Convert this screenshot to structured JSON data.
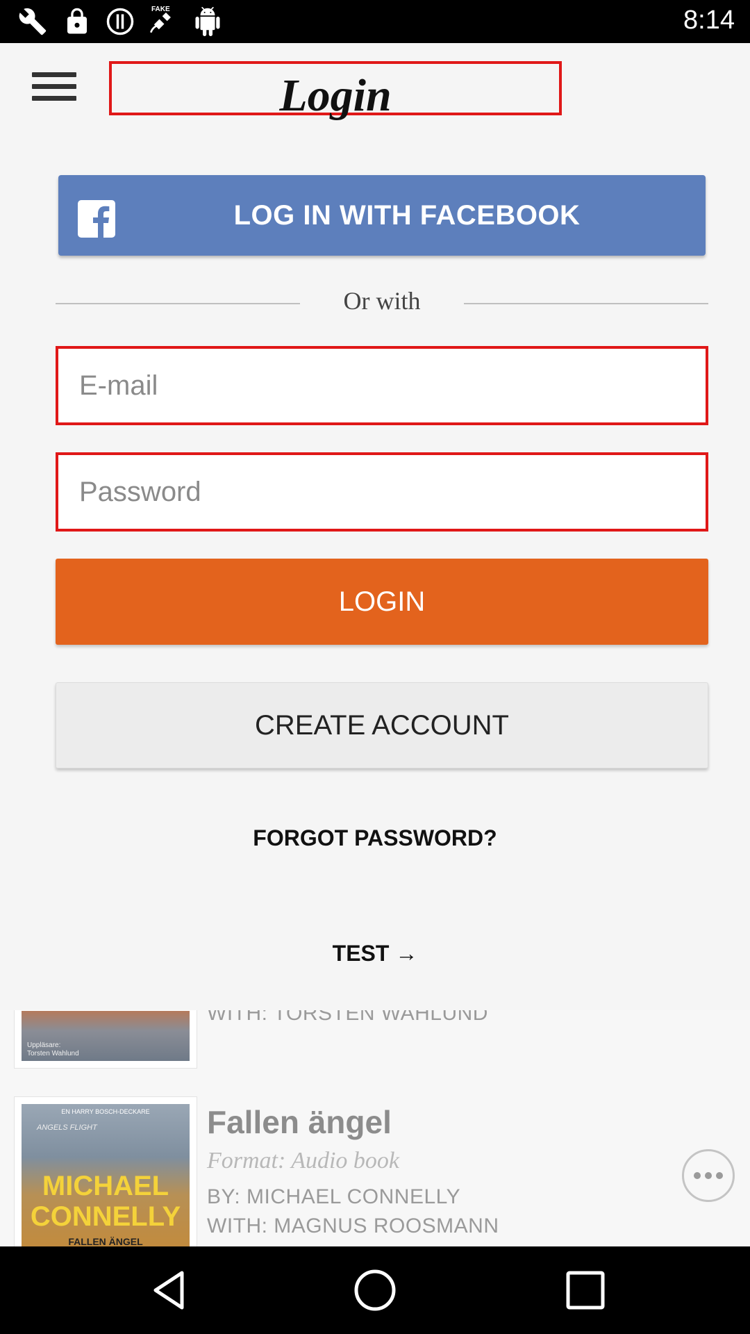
{
  "status_bar": {
    "time": "8:14",
    "icons": [
      "wrench-icon",
      "lock-icon",
      "alert-icon",
      "fake-gps-satellite-icon",
      "android-icon"
    ],
    "fake_gps_label": "FAKE"
  },
  "header": {
    "title": "Login"
  },
  "facebook_button": {
    "label": "LOG IN WITH FACEBOOK",
    "color": "#5d7fbc"
  },
  "divider": {
    "text": "Or with"
  },
  "form": {
    "email_placeholder": "E-mail",
    "email_value": "",
    "password_placeholder": "Password",
    "password_value": ""
  },
  "buttons": {
    "login_label": "LOGIN",
    "login_color": "#e3631d",
    "create_account_label": "CREATE ACCOUNT"
  },
  "links": {
    "forgot_password": "FORGOT PASSWORD?",
    "test": "TEST →"
  },
  "background_list": {
    "items": [
      {
        "meta_with": "WITH: TORSTEN WAHLUND",
        "cover_caption_1": "Uppläsare:",
        "cover_caption_2": "Torsten Wahlund"
      },
      {
        "title": "Fallen ängel",
        "format": "Format: Audio book",
        "meta_by": "BY: MICHAEL CONNELLY",
        "meta_with": "WITH: MAGNUS ROOSMANN",
        "cover_series": "EN HARRY BOSCH-DECKARE",
        "cover_caption": "ANGELS FLIGHT",
        "cover_author_line1": "MICHAEL",
        "cover_author_line2": "CONNELLY",
        "cover_title": "FALLEN ÄNGEL"
      }
    ]
  },
  "nav_bar": {
    "buttons": [
      "back-icon",
      "home-icon",
      "recents-icon"
    ]
  }
}
